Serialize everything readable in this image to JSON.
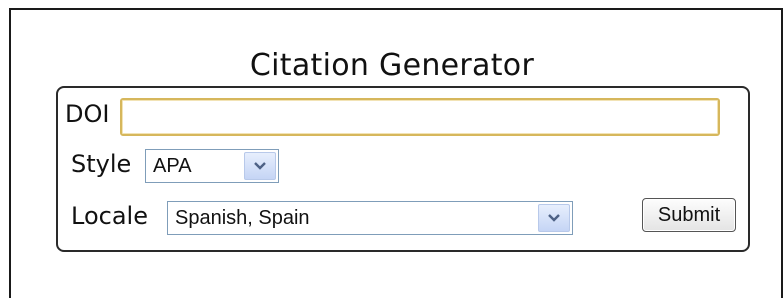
{
  "page": {
    "title": "Citation Generator"
  },
  "form": {
    "doi": {
      "label": "DOI",
      "value": "",
      "placeholder": ""
    },
    "style": {
      "label": "Style",
      "selected": "APA"
    },
    "locale": {
      "label": "Locale",
      "selected": "Spanish, Spain"
    },
    "submit_label": "Submit"
  },
  "colors": {
    "input_focus_border": "#d6b75c",
    "select_border": "#7f9db9",
    "dropdown_button": "#c5d5f5"
  },
  "icons": {
    "dropdown": "chevron-down-icon"
  }
}
